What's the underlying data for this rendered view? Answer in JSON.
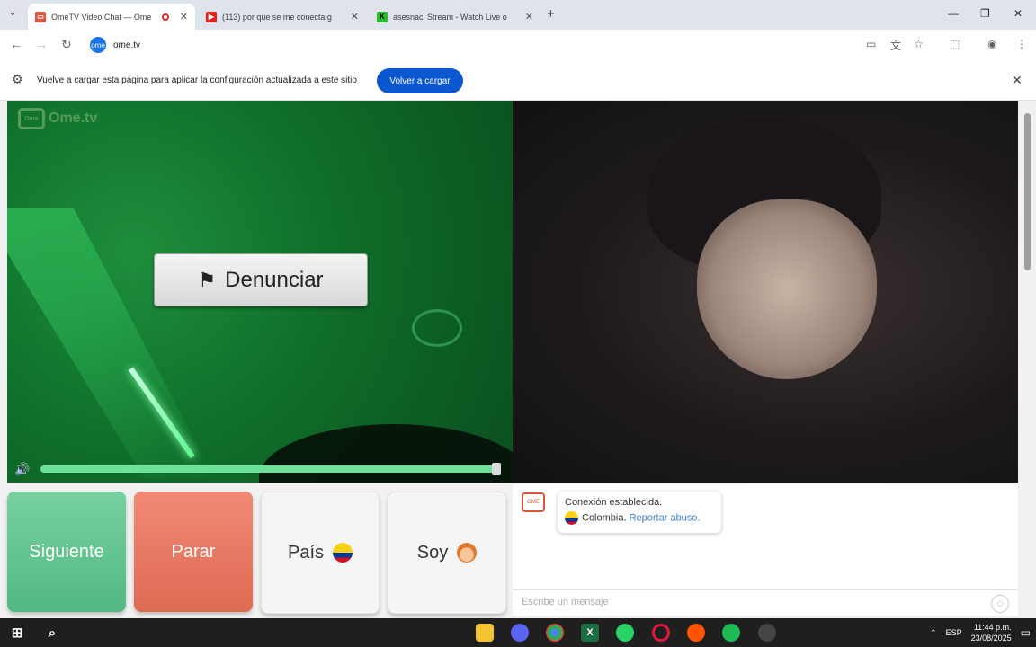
{
  "browser": {
    "tabs": [
      {
        "title": "OmeTV Video Chat — Ome",
        "active": true
      },
      {
        "title": "(113) por que se me conecta g",
        "active": false
      },
      {
        "title": "asesnaci Stream - Watch Live o",
        "active": false
      }
    ],
    "new_tab": "+",
    "url": "ome.tv",
    "infobar_message": "Vuelve a cargar esta página para aplicar la configuración actualizada a este sitio",
    "reload_label": "Volver a cargar"
  },
  "video": {
    "watermark": "Ome.tv",
    "report_label": "Denunciar",
    "volume_level": 0.99
  },
  "controls": {
    "next_label": "Siguiente",
    "stop_label": "Parar",
    "country_label": "País",
    "gender_label": "Soy"
  },
  "chat": {
    "status": "Conexión establecida.",
    "country": "Colombia.",
    "report_link": "Reportar abuso.",
    "input_placeholder": "Escribe un mensaje"
  },
  "taskbar": {
    "language": "ESP",
    "time": "11:44 p.m.",
    "date": "23/08/2025"
  },
  "colors": {
    "next": "#52b882",
    "stop": "#de6a53",
    "reload": "#0b57d0"
  }
}
